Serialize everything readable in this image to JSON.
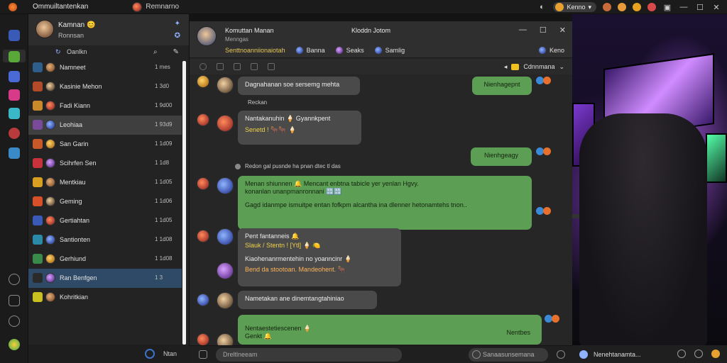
{
  "topbar": {
    "app_title": "Ommuiltantenkan",
    "user_name": "Remnarno",
    "pill_label": "Kenno",
    "icons": [
      "moon-icon",
      "avatar-icon",
      "settings-icon",
      "profile-icon",
      "notification-icon"
    ]
  },
  "profile": {
    "name": "Kamnan 😊",
    "status": "Ronnsan"
  },
  "search": {
    "label": "Oanlkn"
  },
  "chats": [
    {
      "name": "Namneet",
      "time": "1 mes",
      "color": "#2e5f8a"
    },
    {
      "name": "Kasinie Mehon",
      "time": "1 3d0",
      "color": "#b34a2a"
    },
    {
      "name": "Fadi Kiann",
      "time": "1 9d00",
      "color": "#c88a2a"
    },
    {
      "name": "Leohiaa",
      "time": "1 93d9",
      "color": "#7a4a9a",
      "selected": true
    },
    {
      "name": "San Garin",
      "time": "1 1d09",
      "color": "#c85a2a"
    },
    {
      "name": "Scihrfen Sen",
      "time": "1 1d8",
      "color": "#c8323a"
    },
    {
      "name": "Mentkiau",
      "time": "1 1d05",
      "color": "#d8a020"
    },
    {
      "name": "Geming",
      "time": "1 1d06",
      "color": "#d8502a"
    },
    {
      "name": "Gertiahtan",
      "time": "1 1d05",
      "color": "#3a5ab8"
    },
    {
      "name": "Santionten",
      "time": "1 1d08",
      "color": "#2a8aa8"
    },
    {
      "name": "Gerhiund",
      "time": "1 1d08",
      "color": "#3a8a4a"
    },
    {
      "name": "Ran Benfgen",
      "time": "1 3",
      "color": "#2a2a2a",
      "active": true
    },
    {
      "name": "Kohritkian",
      "time": "",
      "color": "#c8c020"
    }
  ],
  "sidebar_bottom": {
    "label": "Ntan"
  },
  "chat": {
    "title": "Komuttan Manan",
    "subtitle": "Menngas",
    "center_label": "Kloddn Jotom",
    "members_online": "Senttnoanniionaiotah",
    "members": [
      "Banna",
      "Seaks",
      "Samlig"
    ],
    "right_label": "Keno",
    "toolbar_right": "Cdnnmana",
    "messages": {
      "m1": "Dagnahanan soe sersemg mehta",
      "m1_sub": "Reckan",
      "m2_line1": "Nantakanuhin 🍦 Gyannkpent",
      "m2_line2": "Senetd ! 🐂🐂 🍦",
      "r1": "Nienhagepnt",
      "r2": "Nienhgeagy",
      "sys1": "Redon gal pusnde ha pnan dtec tl das",
      "g_line1": "Menan shiunnen 🔔 Mencant enbtna tabicle yer yenlan Hgvy.",
      "g_line2": "konanlan unanpmanronnani 🔡🔡",
      "g_line3": "Gagd idanmpe ismuitpe entan fofkpm alcantha ina dlenner hetonamtehs tnon..",
      "m3_line1": "Pent fantanneis 🔔",
      "m3_line2": "Slauk / Stentn ! [Ytl] 🍦 🍋",
      "m3_line3": "Kiaohenanrmentehin no yoanncinr 🍦",
      "m3_line4": "Bend da stootoan. Mandeohent. 🐂",
      "m4": "Nametakan ane dinemtangtahiniao",
      "g2_line1": "Nentaestetiescenen 🍦",
      "g2_line2": "Genkt 🔔",
      "g2_right": "Nentbes"
    }
  },
  "input": {
    "placeholder": "Dreltlneeam",
    "secondary": "Sanaasunsemana",
    "right_label": "Nenehtanamta..."
  }
}
